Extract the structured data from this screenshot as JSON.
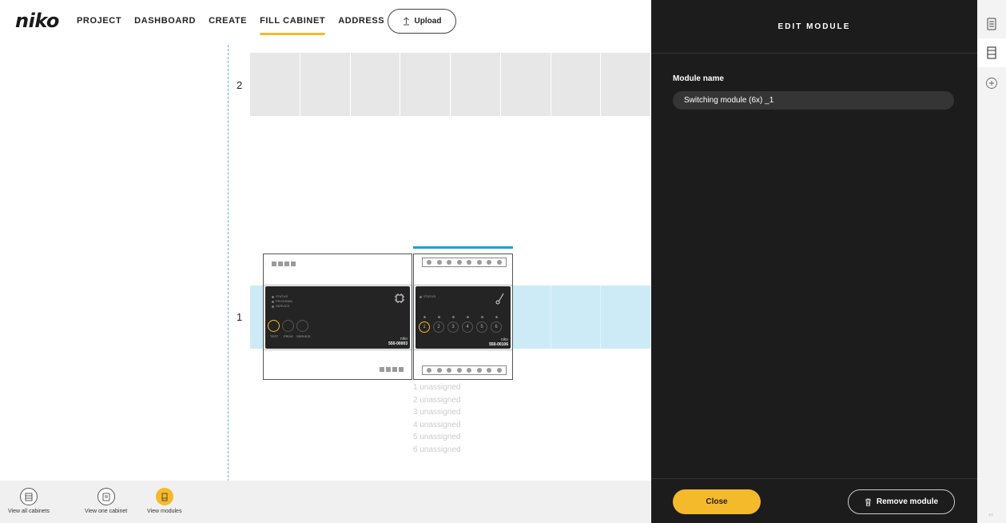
{
  "brand": "niko",
  "nav": {
    "items": [
      {
        "label": "PROJECT"
      },
      {
        "label": "DASHBOARD"
      },
      {
        "label": "CREATE"
      },
      {
        "label": "FILL CABINET",
        "active": true
      },
      {
        "label": "ADDRESS"
      }
    ],
    "upload_label": "Upload"
  },
  "canvas": {
    "rows": [
      {
        "label": "2"
      },
      {
        "label": "1"
      }
    ],
    "module1": {
      "leds": [
        "STATUS",
        "PROGRAM",
        "SERVICE"
      ],
      "buttons": [
        "TEST",
        "PROG",
        "SERVICE"
      ],
      "brand": "niko",
      "code": "550-00003"
    },
    "module2": {
      "led": "STATUS",
      "channels": [
        "1",
        "2",
        "3",
        "4",
        "5",
        "6"
      ],
      "brand": "niko",
      "code": "550-00106"
    },
    "unassigned": [
      "1 unassigned",
      "2 unassigned",
      "3 unassigned",
      "4 unassigned",
      "5 unassigned",
      "6 unassigned"
    ]
  },
  "bottom": {
    "view_all": "View all cabinets",
    "view_one": "View one cabinet",
    "view_modules": "View modules"
  },
  "panel": {
    "title": "EDIT MODULE",
    "field_label": "Module name",
    "field_value": "Switching module (6x) _1",
    "close_label": "Close",
    "remove_label": "Remove module"
  },
  "colors": {
    "accent": "#f5b92c",
    "selection": "#1a9fdf",
    "panel_bg": "#1c1c1c",
    "row_highlight": "#cdebf6"
  },
  "icons": {
    "side_top": "cabinet-list-icon",
    "side_active": "module-icon",
    "side_add": "add-circle-icon",
    "collapse": "collapse-chevron-icon"
  }
}
